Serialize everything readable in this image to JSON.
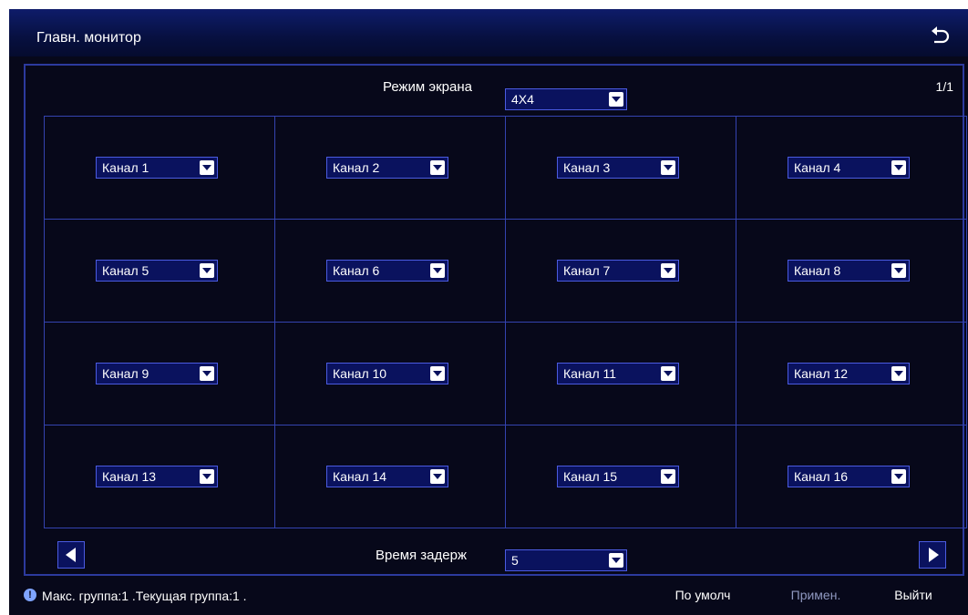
{
  "window": {
    "title": "Главн. монитор"
  },
  "screen_mode": {
    "label": "Режим экрана",
    "value": "4X4"
  },
  "page_indicator": "1/1",
  "channels": [
    "Канал 1",
    "Канал 2",
    "Канал 3",
    "Канал 4",
    "Канал 5",
    "Канал 6",
    "Канал 7",
    "Канал 8",
    "Канал 9",
    "Канал 10",
    "Канал 11",
    "Канал 12",
    "Канал 13",
    "Канал 14",
    "Канал 15",
    "Канал 16"
  ],
  "delay": {
    "label": "Время задерж",
    "value": "5"
  },
  "status": {
    "text": "Макс. группа:1 .Текущая группа:1 ."
  },
  "buttons": {
    "default": "По умолч",
    "apply": "Примен.",
    "exit": "Выйти"
  },
  "colors": {
    "background": "#07081a",
    "accent": "#2c3a9e",
    "select_bg": "#0a125e",
    "disabled_text": "#8f98c0"
  },
  "icons": {
    "back": "back-arrow-icon",
    "prev": "left-triangle-icon",
    "next": "right-triangle-icon",
    "info": "info-icon",
    "dropdown": "dropdown-arrow-icon"
  }
}
